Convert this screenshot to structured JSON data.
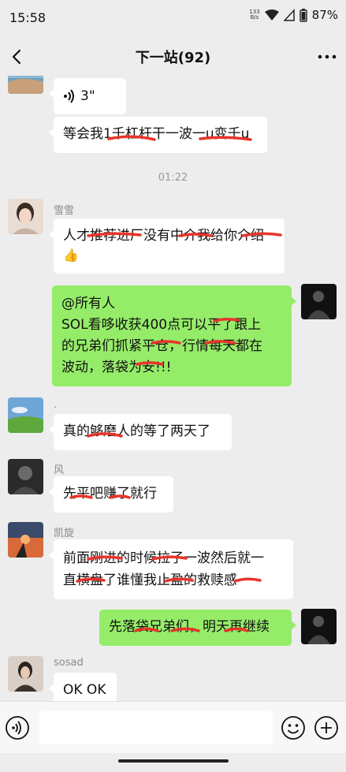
{
  "status_bar": {
    "time": "15:58",
    "net_speed_value": "133",
    "net_speed_unit": "B/s",
    "battery": "87%"
  },
  "header": {
    "title": "下一站(92)"
  },
  "messages": {
    "m1": {
      "text": "3\""
    },
    "m2": {
      "text": "等会我1千杠杆干一波一u变千u"
    },
    "time1": "01:22",
    "m3": {
      "sender": "雪雪",
      "text": "人才推荐进厂没有中介我给你介绍",
      "emoji": "👍"
    },
    "m4": {
      "line1": "@所有人",
      "line2": "SOL看哆收获400点可以平了跟上",
      "line3": "的兄弟们抓紧平仓，行情每天都在",
      "line4": "波动，落袋为安!!!"
    },
    "m5": {
      "sender": ".",
      "text": "真的够磨人的等了两天了"
    },
    "m6": {
      "sender": "风",
      "text": "先平吧赚了就行"
    },
    "m7": {
      "sender": "凯旋",
      "line1": "前面刚进的时候拉了一波然后就一",
      "line2": "直横盘了谁懂我止盈的救赎感"
    },
    "m8": {
      "text": "先落袋兄弟们，明天再继续"
    },
    "m9": {
      "sender": "sosad",
      "text": "OK OK"
    }
  },
  "colors": {
    "self_bubble": "#95ec69",
    "strike": "#e8342a",
    "background": "#ededed"
  }
}
